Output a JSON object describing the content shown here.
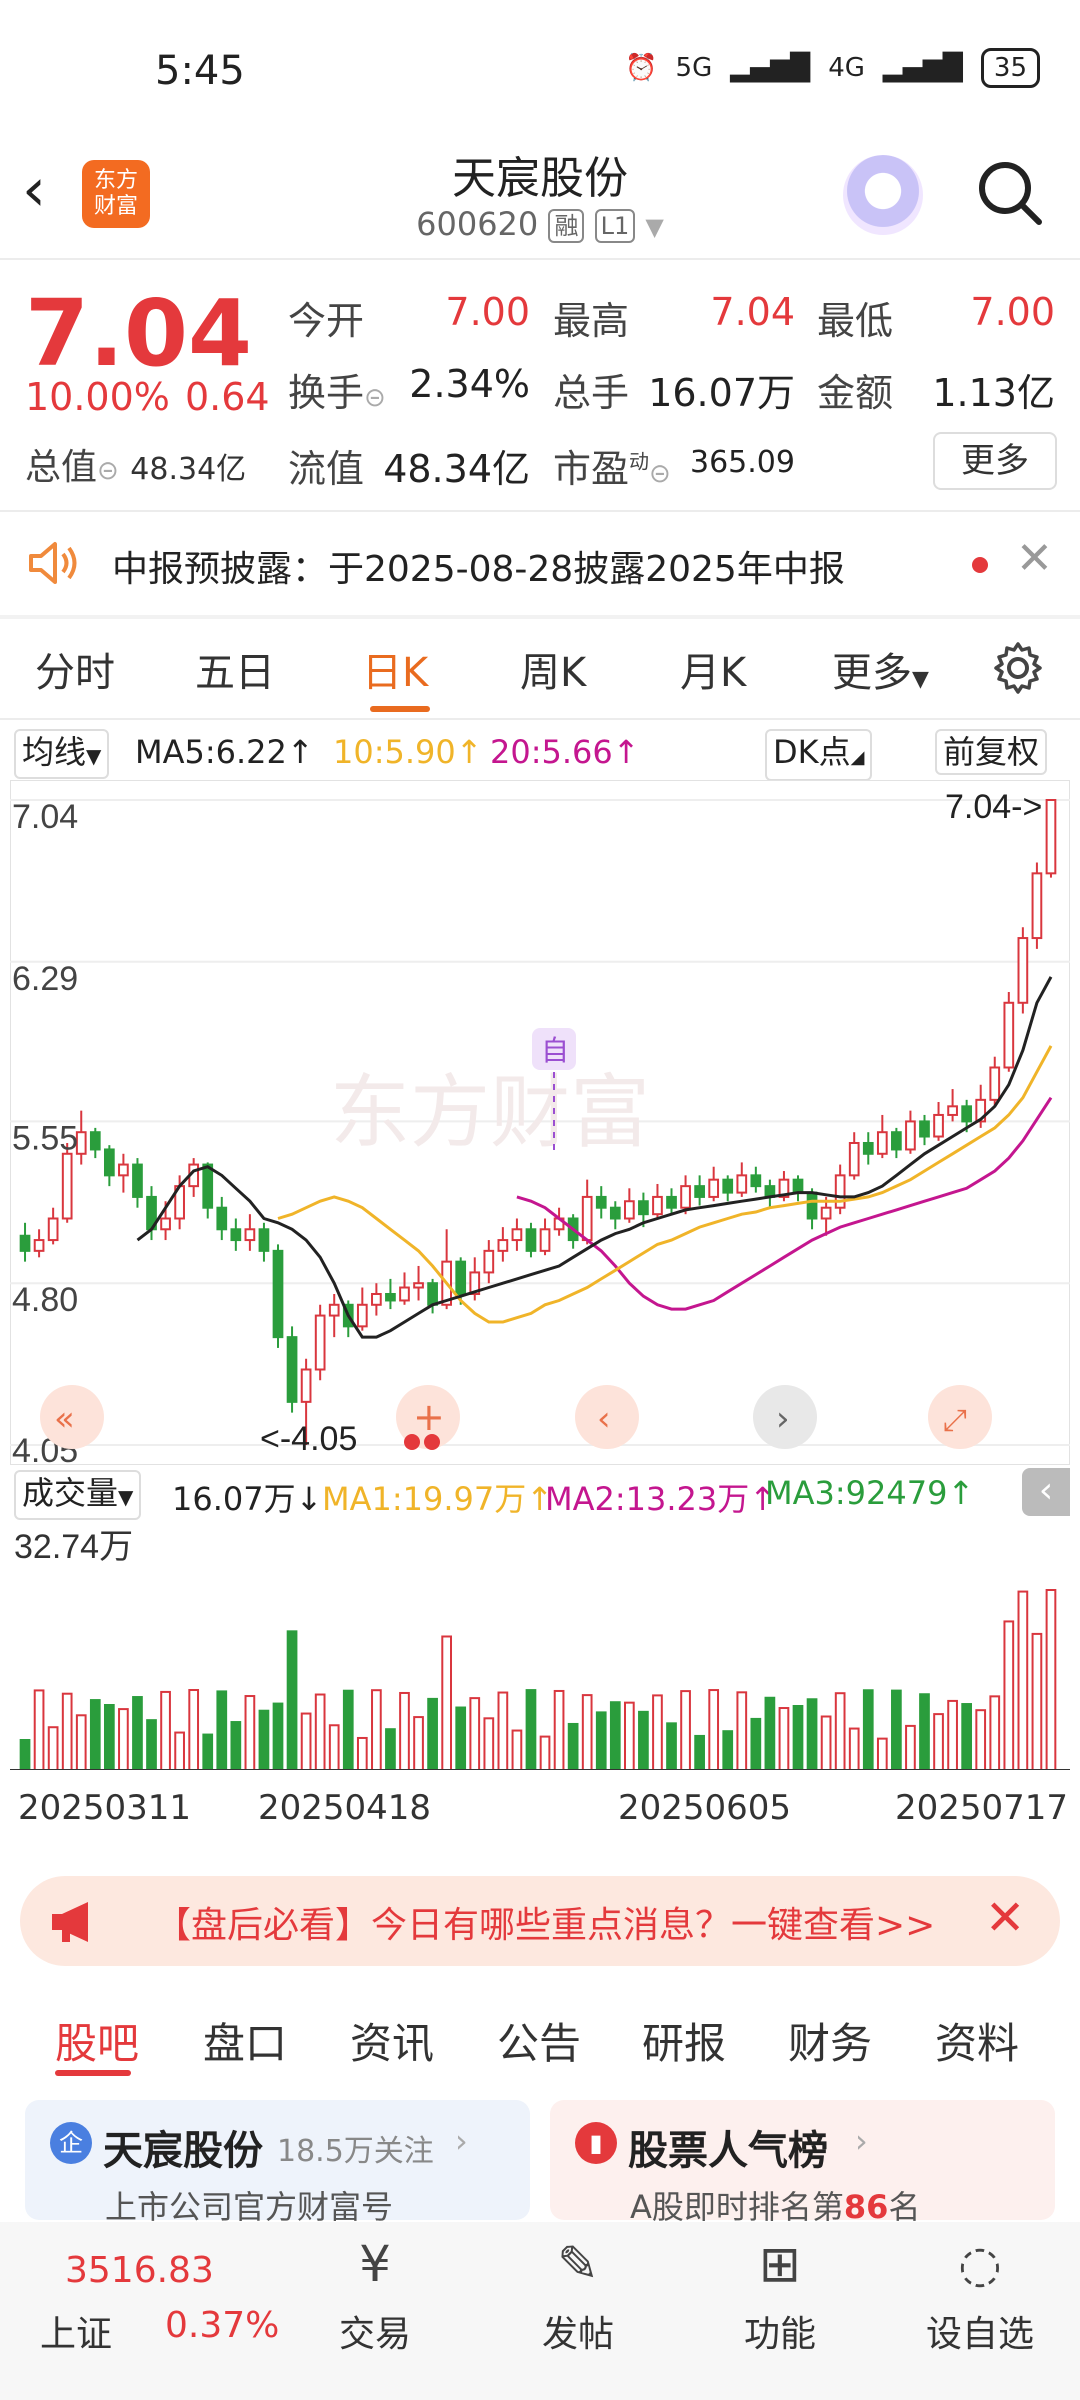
{
  "status_bar": {
    "time": "5:45",
    "network1": "5G",
    "network2": "4G",
    "battery": "35"
  },
  "header": {
    "logo_line1": "东方",
    "logo_line2": "财富",
    "name": "天宸股份",
    "code": "600620",
    "tag1": "融",
    "tag2": "L1"
  },
  "quote": {
    "price": "7.04",
    "change_pct": "10.00%",
    "change_val": "0.64",
    "zongzhi_label": "总值",
    "zongzhi_val": "48.34亿",
    "jinkai_label": "今开",
    "jinkai_val": "7.00",
    "zuigao_label": "最高",
    "zuigao_val": "7.04",
    "zuidi_label": "最低",
    "zuidi_val": "7.00",
    "huanshou_label": "换手",
    "huanshou_val": "2.34%",
    "zongshou_label": "总手",
    "zongshou_val": "16.07万",
    "jine_label": "金额",
    "jine_val": "1.13亿",
    "liuzhi_label": "流值",
    "liuzhi_val": "48.34亿",
    "shiying_label": "市盈",
    "shiying_sup": "动",
    "shiying_val": "365.09",
    "more_label": "更多"
  },
  "notice": {
    "text": "中报预披露：于2025-08-28披露2025年中报"
  },
  "period_tabs": [
    "分时",
    "五日",
    "日K",
    "周K",
    "月K",
    "更多"
  ],
  "ma_row": {
    "selector": "均线",
    "ma5": "MA5:6.22↑",
    "ma10": "10:5.90↑",
    "ma20": "20:5.66↑",
    "dk": "DK点",
    "fq": "前复权"
  },
  "chart": {
    "price_ticks": [
      "7.04",
      "6.29",
      "5.55",
      "4.80",
      "4.05"
    ],
    "latest_label": "7.04->",
    "low_label": "<-4.05",
    "marker_zi": "自",
    "watermark": "东方财富",
    "colors": {
      "up": "#d9363e",
      "down": "#2a9d3c",
      "ma5": "#222222",
      "ma10": "#f0b429",
      "ma20": "#c4168f"
    }
  },
  "volume_row": {
    "selector": "成交量",
    "vol": "16.07万↓",
    "ma1": "MA1:19.97万↑",
    "ma2": "MA2:13.23万↑",
    "ma3": "MA3:92479↑",
    "max_label": "32.74万"
  },
  "x_dates": [
    "20250311",
    "20250418",
    "20250605",
    "20250717"
  ],
  "banner": {
    "text": "【盘后必看】今日有哪些重点消息？一键查看>>"
  },
  "content_tabs": [
    "股吧",
    "盘口",
    "资讯",
    "公告",
    "研报",
    "财务",
    "资料"
  ],
  "card1": {
    "icon": "企",
    "title": "天宸股份",
    "follow": "18.5万关注",
    "sub": "上市公司官方财富号"
  },
  "card2": {
    "title": "股票人气榜",
    "sub_pre": "A股即时排名第",
    "rank": "86",
    "sub_post": "名"
  },
  "footer": {
    "index_val": "3516.83",
    "index_name": "上证",
    "index_pct": "0.37%",
    "items": [
      "交易",
      "发帖",
      "功能",
      "设自选"
    ]
  },
  "chart_data": {
    "type": "candlestick",
    "y_range": [
      4.05,
      7.04
    ],
    "candles": [
      [
        5.02,
        4.95,
        5.08,
        4.9
      ],
      [
        4.95,
        5.0,
        5.05,
        4.92
      ],
      [
        5.0,
        5.1,
        5.15,
        4.98
      ],
      [
        5.1,
        5.4,
        5.45,
        5.08
      ],
      [
        5.4,
        5.5,
        5.6,
        5.35
      ],
      [
        5.5,
        5.42,
        5.52,
        5.38
      ],
      [
        5.42,
        5.3,
        5.44,
        5.25
      ],
      [
        5.3,
        5.35,
        5.4,
        5.22
      ],
      [
        5.35,
        5.2,
        5.38,
        5.15
      ],
      [
        5.2,
        5.05,
        5.25,
        5.0
      ],
      [
        5.05,
        5.1,
        5.18,
        5.0
      ],
      [
        5.1,
        5.25,
        5.3,
        5.05
      ],
      [
        5.25,
        5.35,
        5.38,
        5.2
      ],
      [
        5.35,
        5.15,
        5.36,
        5.1
      ],
      [
        5.15,
        5.05,
        5.2,
        5.0
      ],
      [
        5.05,
        5.0,
        5.1,
        4.95
      ],
      [
        5.0,
        5.05,
        5.12,
        4.95
      ],
      [
        5.05,
        4.95,
        5.08,
        4.9
      ],
      [
        4.95,
        4.55,
        4.98,
        4.5
      ],
      [
        4.55,
        4.25,
        4.6,
        4.2
      ],
      [
        4.25,
        4.4,
        4.45,
        4.05
      ],
      [
        4.4,
        4.65,
        4.7,
        4.35
      ],
      [
        4.65,
        4.7,
        4.75,
        4.55
      ],
      [
        4.7,
        4.6,
        4.72,
        4.55
      ],
      [
        4.6,
        4.7,
        4.78,
        4.58
      ],
      [
        4.7,
        4.75,
        4.8,
        4.65
      ],
      [
        4.75,
        4.72,
        4.82,
        4.68
      ],
      [
        4.72,
        4.78,
        4.85,
        4.7
      ],
      [
        4.78,
        4.8,
        4.88,
        4.72
      ],
      [
        4.8,
        4.7,
        4.82,
        4.66
      ],
      [
        4.7,
        4.9,
        5.05,
        4.68
      ],
      [
        4.9,
        4.75,
        4.92,
        4.7
      ],
      [
        4.75,
        4.85,
        4.92,
        4.72
      ],
      [
        4.85,
        4.95,
        5.0,
        4.8
      ],
      [
        4.95,
        5.0,
        5.06,
        4.9
      ],
      [
        5.0,
        5.05,
        5.1,
        4.95
      ],
      [
        5.05,
        4.95,
        5.08,
        4.92
      ],
      [
        4.95,
        5.05,
        5.1,
        4.93
      ],
      [
        5.05,
        5.1,
        5.15,
        5.02
      ],
      [
        5.1,
        5.0,
        5.12,
        4.96
      ],
      [
        5.0,
        5.2,
        5.28,
        4.98
      ],
      [
        5.2,
        5.15,
        5.25,
        5.1
      ],
      [
        5.15,
        5.1,
        5.18,
        5.05
      ],
      [
        5.1,
        5.18,
        5.24,
        5.08
      ],
      [
        5.18,
        5.12,
        5.22,
        5.06
      ],
      [
        5.12,
        5.2,
        5.26,
        5.1
      ],
      [
        5.2,
        5.15,
        5.24,
        5.12
      ],
      [
        5.15,
        5.25,
        5.3,
        5.12
      ],
      [
        5.25,
        5.2,
        5.3,
        5.16
      ],
      [
        5.2,
        5.28,
        5.34,
        5.18
      ],
      [
        5.28,
        5.22,
        5.3,
        5.18
      ],
      [
        5.22,
        5.3,
        5.36,
        5.2
      ],
      [
        5.3,
        5.25,
        5.34,
        5.22
      ],
      [
        5.25,
        5.2,
        5.28,
        5.15
      ],
      [
        5.2,
        5.28,
        5.32,
        5.18
      ],
      [
        5.28,
        5.22,
        5.3,
        5.18
      ],
      [
        5.22,
        5.1,
        5.24,
        5.05
      ],
      [
        5.1,
        5.15,
        5.2,
        5.02
      ],
      [
        5.15,
        5.3,
        5.35,
        5.12
      ],
      [
        5.3,
        5.45,
        5.5,
        5.28
      ],
      [
        5.45,
        5.4,
        5.5,
        5.35
      ],
      [
        5.4,
        5.5,
        5.58,
        5.38
      ],
      [
        5.5,
        5.42,
        5.52,
        5.38
      ],
      [
        5.42,
        5.55,
        5.6,
        5.4
      ],
      [
        5.55,
        5.48,
        5.58,
        5.44
      ],
      [
        5.48,
        5.58,
        5.64,
        5.46
      ],
      [
        5.58,
        5.62,
        5.7,
        5.55
      ],
      [
        5.62,
        5.55,
        5.65,
        5.5
      ],
      [
        5.55,
        5.65,
        5.72,
        5.52
      ],
      [
        5.65,
        5.8,
        5.85,
        5.62
      ],
      [
        5.8,
        6.1,
        6.15,
        5.78
      ],
      [
        6.1,
        6.4,
        6.45,
        6.05
      ],
      [
        6.4,
        6.7,
        6.75,
        6.35
      ],
      [
        6.7,
        7.04,
        7.04,
        6.68
      ]
    ],
    "ma5": [
      5.0,
      5.05,
      5.15,
      5.25,
      5.32,
      5.34,
      5.3,
      5.24,
      5.18,
      5.1,
      5.08,
      5.05,
      5.0,
      4.92,
      4.8,
      4.65,
      4.55,
      4.55,
      4.58,
      4.62,
      4.66,
      4.7,
      4.72,
      4.74,
      4.76,
      4.78,
      4.8,
      4.82,
      4.84,
      4.86,
      4.88,
      4.92,
      4.96,
      5.0,
      5.03,
      5.05,
      5.08,
      5.1,
      5.12,
      5.14,
      5.15,
      5.16,
      5.17,
      5.18,
      5.19,
      5.2,
      5.21,
      5.22,
      5.22,
      5.21,
      5.2,
      5.2,
      5.22,
      5.25,
      5.3,
      5.35,
      5.4,
      5.44,
      5.48,
      5.52,
      5.56,
      5.62,
      5.72,
      5.88,
      6.1,
      6.22
    ],
    "ma10": [
      5.1,
      5.12,
      5.15,
      5.18,
      5.2,
      5.18,
      5.15,
      5.1,
      5.05,
      5.0,
      4.95,
      4.88,
      4.8,
      4.72,
      4.66,
      4.62,
      4.62,
      4.64,
      4.66,
      4.7,
      4.72,
      4.75,
      4.78,
      4.82,
      4.86,
      4.9,
      4.94,
      4.98,
      5.0,
      5.03,
      5.06,
      5.08,
      5.1,
      5.12,
      5.13,
      5.15,
      5.16,
      5.17,
      5.18,
      5.18,
      5.18,
      5.19,
      5.2,
      5.22,
      5.25,
      5.28,
      5.32,
      5.36,
      5.4,
      5.44,
      5.48,
      5.52,
      5.58,
      5.66,
      5.78,
      5.9
    ],
    "ma20": [
      5.2,
      5.18,
      5.15,
      5.1,
      5.05,
      5.0,
      4.95,
      4.88,
      4.8,
      4.74,
      4.7,
      4.68,
      4.68,
      4.7,
      4.72,
      4.76,
      4.8,
      4.84,
      4.88,
      4.92,
      4.96,
      5.0,
      5.03,
      5.06,
      5.08,
      5.1,
      5.12,
      5.14,
      5.16,
      5.18,
      5.2,
      5.22,
      5.24,
      5.28,
      5.32,
      5.38,
      5.46,
      5.56,
      5.66
    ],
    "volume_max": "32.74万"
  }
}
